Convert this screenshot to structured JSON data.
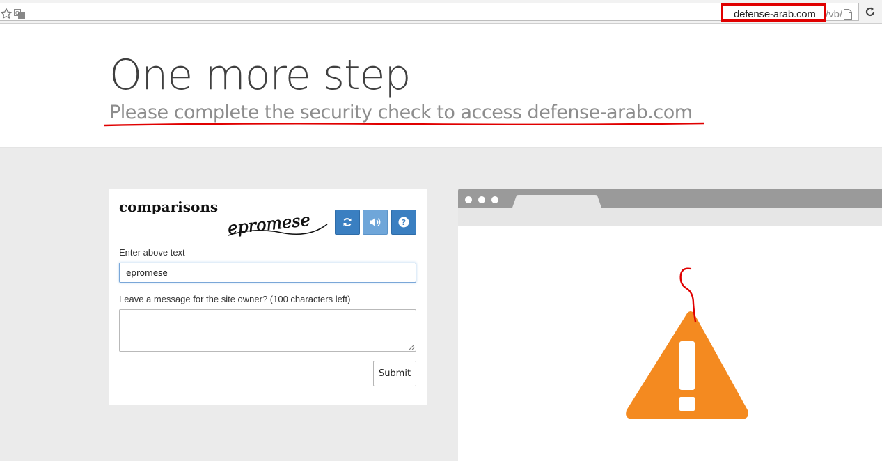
{
  "browser": {
    "url_highlighted": "defense-arab.com",
    "url_rest": "/vb/",
    "icons": [
      "star-icon",
      "translate-icon",
      "page-icon",
      "reload-icon"
    ]
  },
  "header": {
    "title": "One more step",
    "subtitle": "Please complete the security check to access defense-arab.com"
  },
  "form": {
    "captcha_word": "comparisons",
    "captcha_distorted": "epromese",
    "buttons": {
      "refresh_icon": "refresh-icon",
      "audio_icon": "audio-icon",
      "help_icon": "help-icon"
    },
    "enter_label": "Enter above text",
    "captcha_value": "epromese",
    "message_label": "Leave a message for the site owner? (100 characters left)",
    "message_value": "",
    "submit_label": "Submit"
  },
  "illustration": {
    "icon": "warning-icon"
  },
  "colors": {
    "primary_button": "#3a7fc1",
    "audio_button": "#6fa6d9",
    "warning_orange": "#f48a20",
    "annotation_red": "#e00000"
  }
}
